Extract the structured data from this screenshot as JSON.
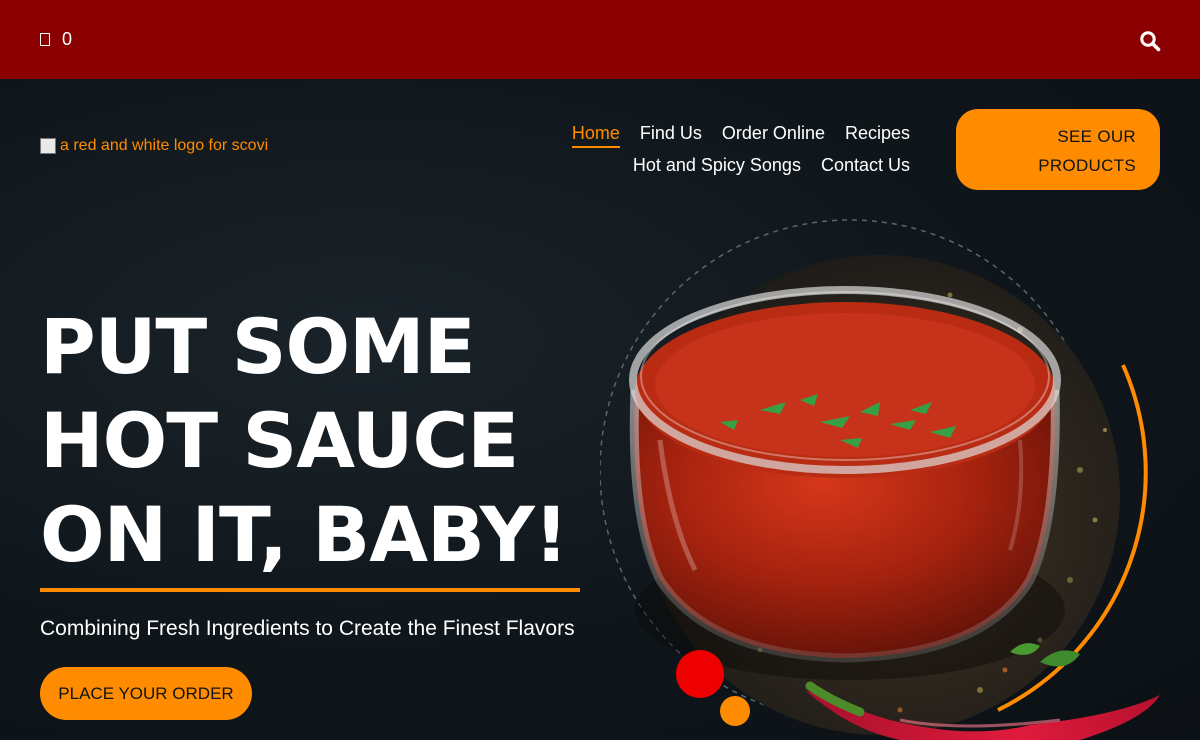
{
  "topbar": {
    "cart_count": "0",
    "cart_icon": "cart-icon",
    "search_icon": "search-icon",
    "background": "#8b0000"
  },
  "header": {
    "logo_alt": "a red and white logo for scovi",
    "nav": [
      {
        "label": "Home",
        "active": true
      },
      {
        "label": "Find Us",
        "active": false
      },
      {
        "label": "Order Online",
        "active": false
      },
      {
        "label": "Recipes",
        "active": false
      },
      {
        "label": "Hot and Spicy Songs",
        "active": false
      },
      {
        "label": "Contact Us",
        "active": false
      }
    ],
    "cta_label_line1": "SEE OUR",
    "cta_label_line2": "PRODUCTS"
  },
  "hero": {
    "headline_line1": "PUT SOME",
    "headline_line2": "HOT SAUCE",
    "headline_line3": "ON IT, BABY!",
    "subtitle": "Combining Fresh Ingredients to Create the Finest Flavors",
    "cta_label": "PLACE YOUR ORDER",
    "accent": "#ff8c00"
  }
}
